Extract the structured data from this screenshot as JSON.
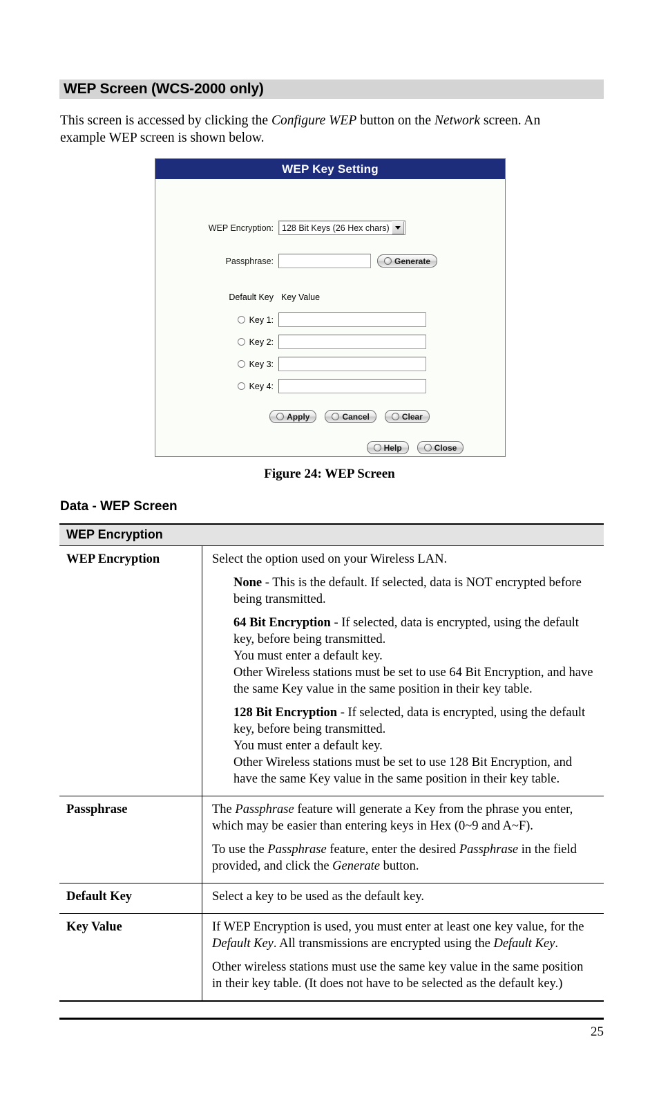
{
  "section": {
    "heading": "WEP Screen (WCS-2000 only)",
    "intro_parts": {
      "a": "This screen is accessed by clicking the ",
      "b": "Configure WEP",
      "c": " button on the ",
      "d": "Network",
      "e": " screen. An example WEP screen is shown below."
    }
  },
  "screenshot": {
    "title": "WEP Key Setting",
    "wep_encryption_label": "WEP Encryption:",
    "wep_encryption_value": "128 Bit Keys (26 Hex chars)",
    "passphrase_label": "Passphrase:",
    "passphrase_value": "",
    "generate_button": "Generate",
    "default_key_header": "Default Key",
    "key_value_header": "Key Value",
    "keys": [
      {
        "label": "Key 1:",
        "value": "",
        "selected": false
      },
      {
        "label": "Key 2:",
        "value": "",
        "selected": false
      },
      {
        "label": "Key 3:",
        "value": "",
        "selected": false
      },
      {
        "label": "Key 4:",
        "value": "",
        "selected": false
      }
    ],
    "buttons_row1": [
      "Apply",
      "Cancel",
      "Clear"
    ],
    "buttons_row2": [
      "Help",
      "Close"
    ],
    "colors": {
      "title_bar": "#1d2d7c",
      "title_text": "#ffffff",
      "dialog_bg": "#fbfdf8"
    }
  },
  "figure_caption": "Figure 24: WEP Screen",
  "sub_heading": "Data - WEP Screen",
  "table": {
    "header": "WEP Encryption",
    "rows": [
      {
        "label": "WEP Encryption",
        "paras": [
          {
            "indent": false,
            "text": "Select the option used on your Wireless LAN."
          },
          {
            "indent": true,
            "bold": "None",
            "text": " - This is the default. If selected, data is NOT encrypted before being transmitted."
          },
          {
            "indent": true,
            "bold": "64 Bit Encryption",
            "text": " - If selected, data is encrypted, using the default key, before being transmitted.",
            "line2": "You must enter a default key.",
            "line3": "Other Wireless stations must be set to use 64 Bit Encryption, and have the same Key value in the same position in their key table."
          },
          {
            "indent": true,
            "bold": "128 Bit Encryption",
            "text": " - If selected, data is encrypted, using the default key, before being transmitted.",
            "line2": "You must enter a default key.",
            "line3": "Other Wireless stations must be set to use 128 Bit Encryption, and have the same Key value in the same position in their key table."
          }
        ]
      },
      {
        "label": "Passphrase",
        "paras": [
          {
            "indent": false,
            "text": "The Passphrase feature will generate a Key from the phrase you enter, which may be easier than entering keys in Hex (0~9 and A~F)."
          },
          {
            "indent": false,
            "text": "To use the Passphrase feature, enter the desired Passphrase in the field provided, and click the Generate button."
          }
        ]
      },
      {
        "label": "Default Key",
        "paras": [
          {
            "indent": false,
            "text": "Select a key to be used as the default key."
          }
        ]
      },
      {
        "label": "Key Value",
        "paras": [
          {
            "indent": false,
            "text": "If WEP Encryption is used, you must enter at least one key value, for the Default Key. All transmissions are encrypted using the Default Key."
          },
          {
            "indent": false,
            "text": "Other wireless stations must use the same key value in the same position in their key table. (It does not have to be selected as the default key.)"
          }
        ]
      }
    ]
  },
  "footer": {
    "page_number": "25"
  }
}
